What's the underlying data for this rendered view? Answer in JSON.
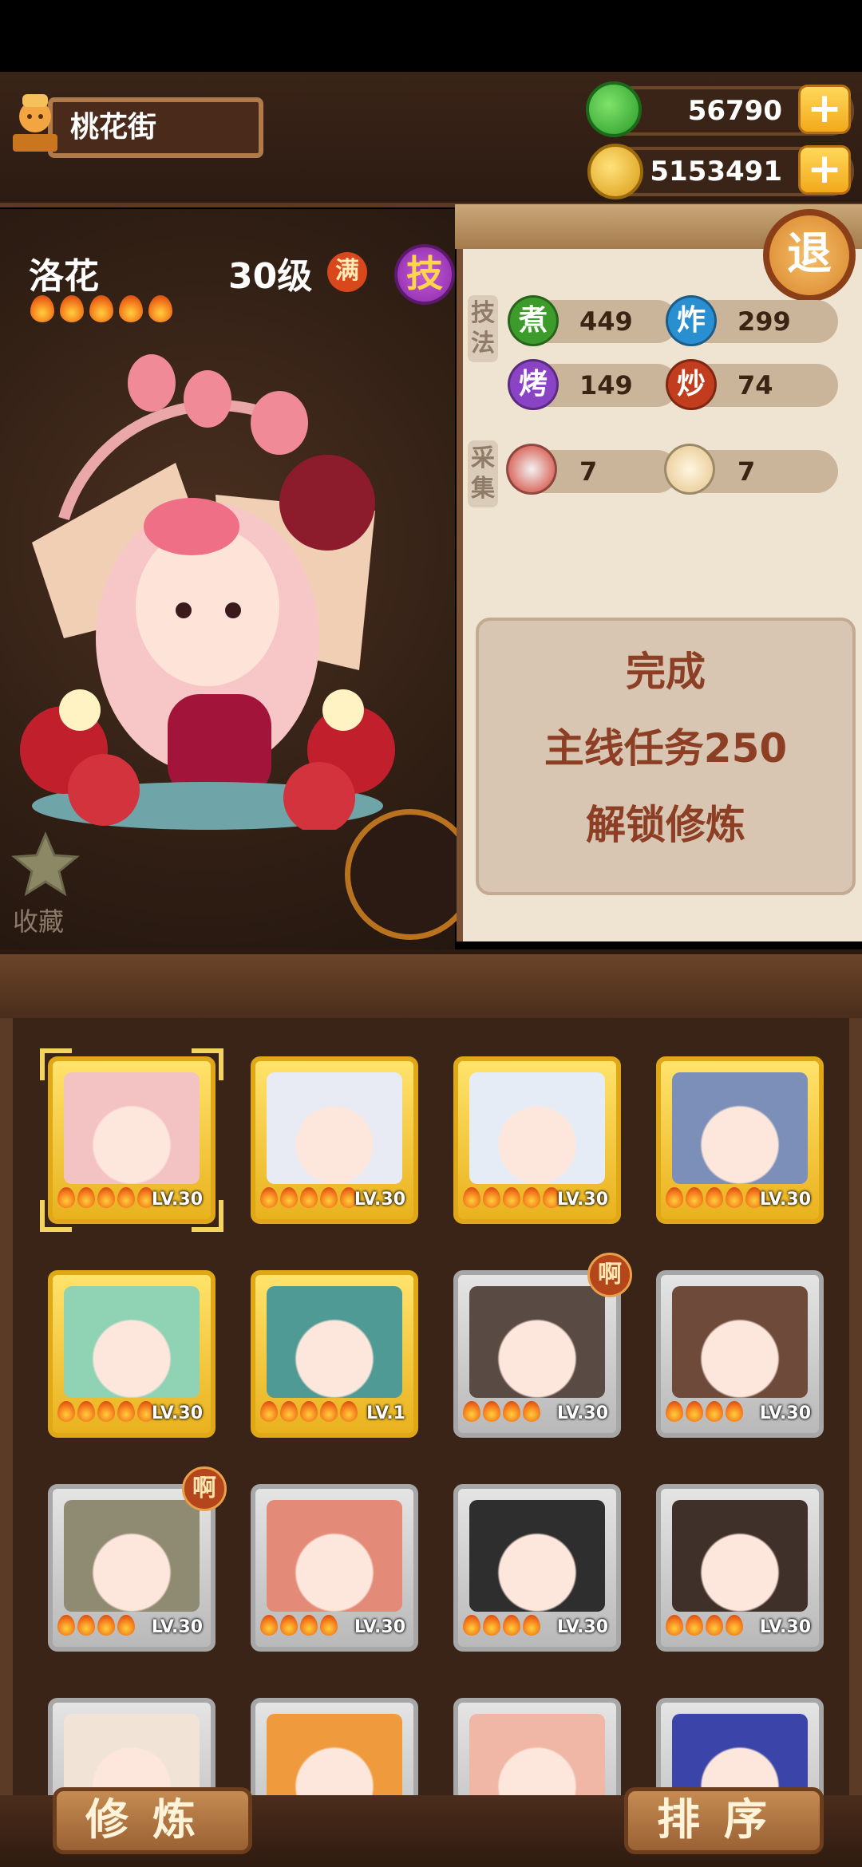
{
  "location": {
    "name": "桃花街",
    "icon": "chef-statue-icon"
  },
  "currency": {
    "jade": {
      "value": "56790",
      "icon": "jade-coin-icon"
    },
    "coins": {
      "value": "5153491",
      "icon": "gold-coin-icon"
    },
    "add_label": "+"
  },
  "exit_label": "退",
  "character": {
    "name": "洛花",
    "level": "30级",
    "max_badge": "满",
    "skill_button": "技",
    "stars": 5
  },
  "favorite_label": "收藏",
  "stats": {
    "technique_label": "技法",
    "gather_label": "采集",
    "cook": [
      {
        "glyph": "煮",
        "value": "449",
        "color": "#3d9b2c"
      },
      {
        "glyph": "炸",
        "value": "299",
        "color": "#2a8fd1"
      },
      {
        "glyph": "烤",
        "value": "149",
        "color": "#8a43c4"
      },
      {
        "glyph": "炒",
        "value": "74",
        "color": "#c23c1e"
      }
    ],
    "gather": [
      {
        "icon": "meat-icon",
        "value": "7"
      },
      {
        "icon": "bun-icon",
        "value": "7"
      }
    ]
  },
  "unlock_message": [
    "完成",
    "主线任务250",
    "解锁修炼"
  ],
  "roster": [
    {
      "level": "LV.30",
      "flames": 5,
      "frame": "gold",
      "selected": true,
      "badge": "",
      "color": "#f3c2c2"
    },
    {
      "level": "LV.30",
      "flames": 5,
      "frame": "gold",
      "selected": false,
      "badge": "",
      "color": "#e8eaf4"
    },
    {
      "level": "LV.30",
      "flames": 5,
      "frame": "gold",
      "selected": false,
      "badge": "",
      "color": "#e6ecf6"
    },
    {
      "level": "LV.30",
      "flames": 5,
      "frame": "gold",
      "selected": false,
      "badge": "",
      "color": "#7b8fb8"
    },
    {
      "level": "LV.30",
      "flames": 5,
      "frame": "gold",
      "selected": false,
      "badge": "",
      "color": "#8fd2b4"
    },
    {
      "level": "LV.1",
      "flames": 5,
      "frame": "gold",
      "selected": false,
      "badge": "",
      "color": "#4f9a94"
    },
    {
      "level": "LV.30",
      "flames": 4,
      "frame": "silver",
      "selected": false,
      "badge": "啊",
      "color": "#5a4a44"
    },
    {
      "level": "LV.30",
      "flames": 4,
      "frame": "silver",
      "selected": false,
      "badge": "",
      "color": "#6e4a3a"
    },
    {
      "level": "LV.30",
      "flames": 4,
      "frame": "silver",
      "selected": false,
      "badge": "啊",
      "color": "#8f8a72"
    },
    {
      "level": "LV.30",
      "flames": 4,
      "frame": "silver",
      "selected": false,
      "badge": "",
      "color": "#e48a78"
    },
    {
      "level": "LV.30",
      "flames": 4,
      "frame": "silver",
      "selected": false,
      "badge": "",
      "color": "#2e2e2e"
    },
    {
      "level": "LV.30",
      "flames": 4,
      "frame": "silver",
      "selected": false,
      "badge": "",
      "color": "#3f3029"
    },
    {
      "level": "",
      "flames": 0,
      "frame": "silver",
      "selected": false,
      "badge": "",
      "color": "#f1e4d6"
    },
    {
      "level": "",
      "flames": 0,
      "frame": "silver",
      "selected": false,
      "badge": "",
      "color": "#f09a3e"
    },
    {
      "level": "",
      "flames": 0,
      "frame": "silver",
      "selected": false,
      "badge": "",
      "color": "#f0b6a6"
    },
    {
      "level": "",
      "flames": 0,
      "frame": "silver",
      "selected": false,
      "badge": "",
      "color": "#3b44a8"
    }
  ],
  "bottom": {
    "train_label": "修炼",
    "sort_label": "排序"
  }
}
